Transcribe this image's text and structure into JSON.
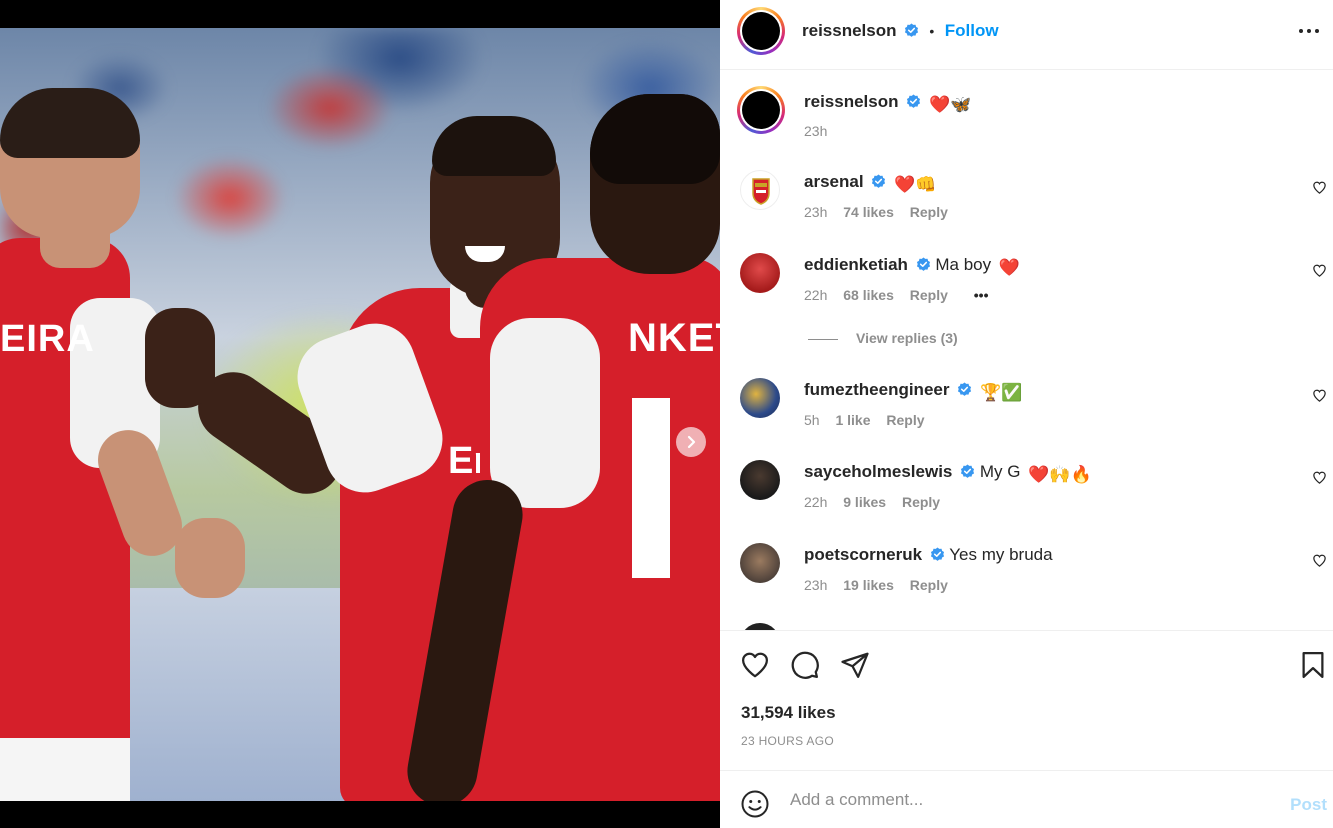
{
  "post": {
    "author": "reissnelson",
    "follow_label": "Follow",
    "separator": "•",
    "caption": {
      "username": "reissnelson",
      "emojis": "❤️🦋",
      "time": "23h"
    },
    "likes_text": "31,594 likes",
    "time_ago": "23 HOURS AGO"
  },
  "comments": [
    {
      "username": "arsenal",
      "text": "",
      "emojis": "❤️👊",
      "time": "23h",
      "likes": "74 likes",
      "reply": "Reply"
    },
    {
      "username": "eddienketiah",
      "text": "Ma boy",
      "emojis": "❤️",
      "time": "22h",
      "likes": "68 likes",
      "reply": "Reply",
      "more": "•••"
    },
    {
      "username": "fumeztheengineer",
      "text": "",
      "emojis": "🏆✅",
      "time": "5h",
      "likes": "1 like",
      "reply": "Reply"
    },
    {
      "username": "sayceholmeslewis",
      "text": "My G",
      "emojis": "❤️🙌🔥",
      "time": "22h",
      "likes": "9 likes",
      "reply": "Reply"
    },
    {
      "username": "poetscorneruk",
      "text": "Yes my bruda",
      "emojis": "",
      "time": "23h",
      "likes": "19 likes",
      "reply": "Reply"
    }
  ],
  "view_replies": "View replies (3)",
  "composer": {
    "placeholder": "Add a comment...",
    "post_label": "Post"
  },
  "media": {
    "shirt_text_left": "EIRA",
    "shirt_text_right": "NKET",
    "sponsor": "Em"
  },
  "colors": {
    "accent": "#0095f6",
    "arsenal_red": "#d51f2a",
    "verified": "#3897f0"
  }
}
